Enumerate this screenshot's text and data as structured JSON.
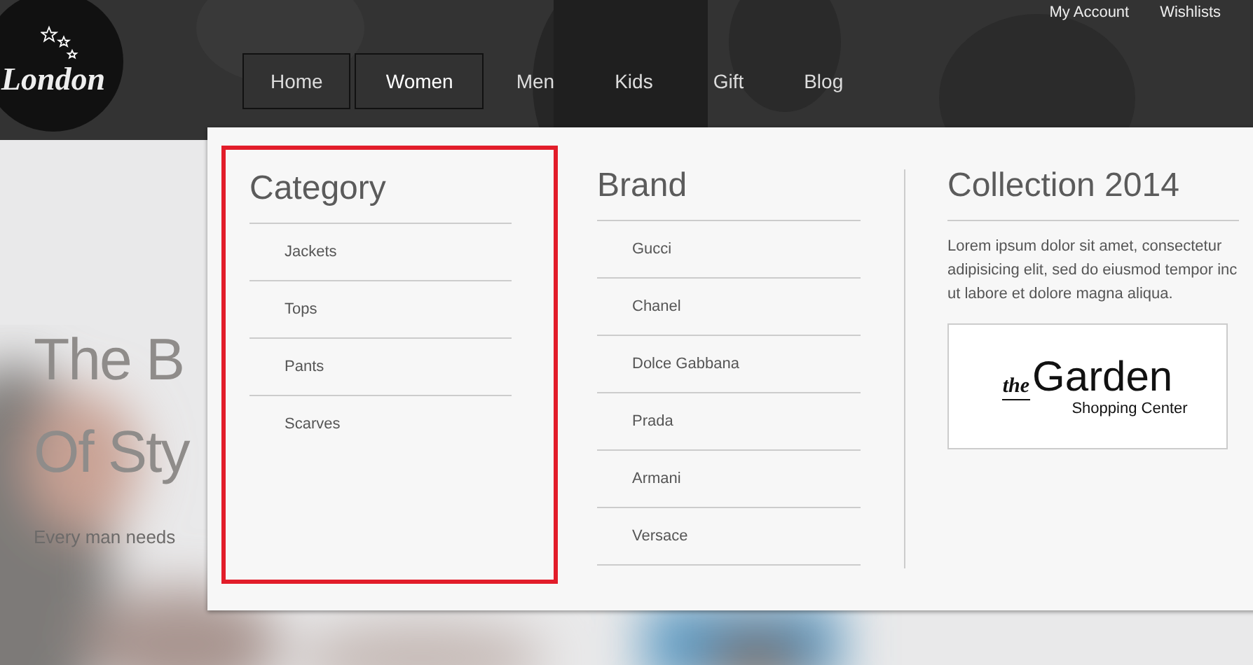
{
  "logo": {
    "text": "London"
  },
  "top_links": [
    "My Account",
    "Wishlists"
  ],
  "nav": [
    {
      "label": "Home",
      "selected": false,
      "outlined": true
    },
    {
      "label": "Women",
      "selected": true,
      "outlined": true
    },
    {
      "label": "Men",
      "selected": false,
      "outlined": false
    },
    {
      "label": "Kids",
      "selected": false,
      "outlined": false
    },
    {
      "label": "Gift",
      "selected": false,
      "outlined": false
    },
    {
      "label": "Blog",
      "selected": false,
      "outlined": false
    }
  ],
  "hero": {
    "title_lines": [
      "The B",
      "Of Sty"
    ],
    "subtitle": "Every man needs"
  },
  "mega_menu": {
    "columns": [
      {
        "kind": "links",
        "title": "Category",
        "highlighted": true,
        "items": [
          "Jackets",
          "Tops",
          "Pants",
          "Scarves"
        ]
      },
      {
        "kind": "links",
        "title": "Brand",
        "items": [
          "Gucci",
          "Chanel",
          "Dolce Gabbana",
          "Prada",
          "Armani",
          "Versace"
        ]
      },
      {
        "kind": "promo",
        "title": "Collection 2014",
        "text": "Lorem ipsum dolor sit amet, consectetur adipisicing elit, sed do eiusmod tempor inc ut labore et dolore magna aliqua.",
        "logo": {
          "small": "the",
          "big": "Garden",
          "tagline": "Shopping Center"
        }
      }
    ]
  }
}
